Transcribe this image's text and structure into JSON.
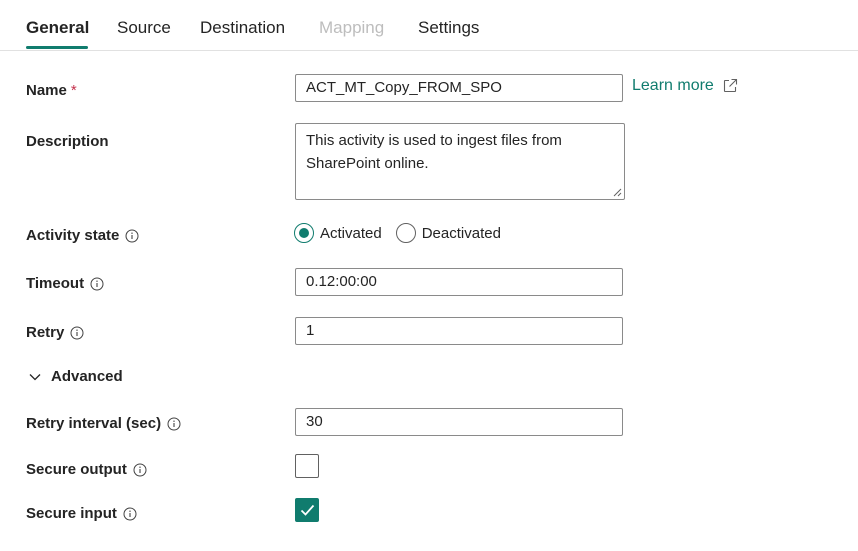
{
  "tabs": [
    {
      "label": "General",
      "active": true
    },
    {
      "label": "Source"
    },
    {
      "label": "Destination"
    },
    {
      "label": "Mapping",
      "disabled": true
    },
    {
      "label": "Settings"
    }
  ],
  "form": {
    "name": {
      "label": "Name",
      "required_mark": "*",
      "value": "ACT_MT_Copy_FROM_SPO"
    },
    "learn_more": {
      "label": "Learn more",
      "icon": "external-link-icon"
    },
    "description": {
      "label": "Description",
      "value": "This activity is used to ingest files from SharePoint online."
    },
    "activity_state": {
      "label": "Activity state",
      "options": [
        {
          "label": "Activated",
          "selected": true
        },
        {
          "label": "Deactivated",
          "selected": false
        }
      ]
    },
    "timeout": {
      "label": "Timeout",
      "value": "0.12:00:00"
    },
    "retry": {
      "label": "Retry",
      "value": "1"
    },
    "advanced": {
      "label": "Advanced",
      "expanded": true
    },
    "retry_interval": {
      "label": "Retry interval (sec)",
      "value": "30"
    },
    "secure_output": {
      "label": "Secure output",
      "checked": false
    },
    "secure_input": {
      "label": "Secure input",
      "checked": true
    }
  },
  "colors": {
    "accent": "#107c6e",
    "required": "#c4314b",
    "disabled_text": "#bdbdbd"
  }
}
